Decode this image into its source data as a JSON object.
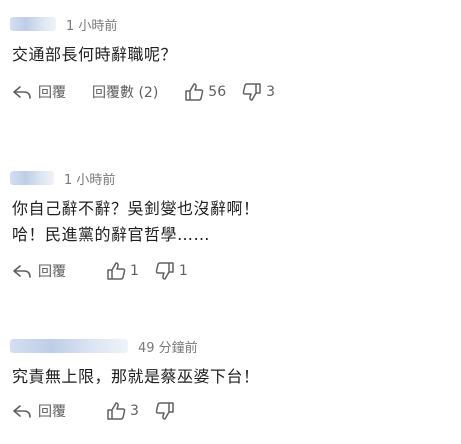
{
  "comments": [
    {
      "time": "1 小時前",
      "lines": [
        "交通部長何時辭職呢？"
      ],
      "reply_label": "回覆",
      "replies_label": "回覆數 (2)",
      "likes": "56",
      "dislikes": "3"
    },
    {
      "time": "1 小時前",
      "lines": [
        "你自己辭不辭？吳釗燮也沒辭啊！",
        "哈！民進黨的辭官哲學……"
      ],
      "reply_label": "回覆",
      "likes": "1",
      "dislikes": "1"
    },
    {
      "time": "49 分鐘前",
      "lines": [
        "究責無上限，那就是蔡巫婆下台！"
      ],
      "reply_label": "回覆",
      "likes": "3",
      "dislikes": ""
    }
  ],
  "icons": {
    "reply": "reply-arrow-icon",
    "like": "thumbs-up-icon",
    "dislike": "thumbs-down-icon"
  },
  "colors": {
    "text": "#1f1f1f",
    "meta": "#7a7a7a",
    "action": "#606060"
  }
}
